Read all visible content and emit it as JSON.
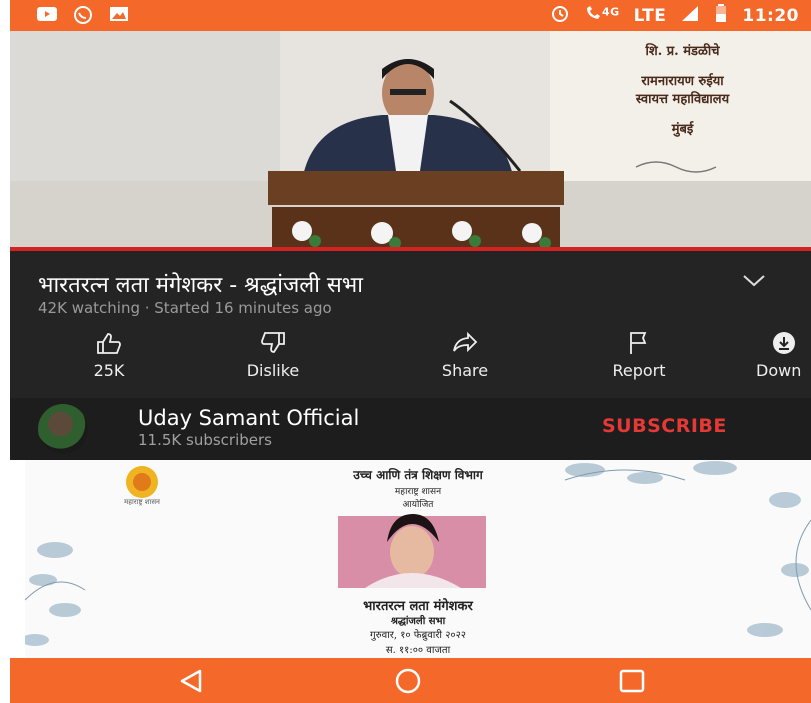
{
  "status_bar": {
    "time": "11:20",
    "network_small": "4G",
    "network": "LTE",
    "icons": [
      "youtube-notification-icon",
      "whatsapp-icon",
      "gallery-icon",
      "alarm-icon",
      "call-4g-icon",
      "signal-icon",
      "battery-icon"
    ]
  },
  "video": {
    "slide_lines": [
      "शि. प्र. मंडळीचे",
      "रामनारायण रुईया",
      "स्वायत्त महाविद्यालय",
      "मुंबई"
    ]
  },
  "info": {
    "title": "भारतरत्न लता मंगेशकर - श्रद्धांजली सभा",
    "meta": "42K watching · Started 16 minutes ago"
  },
  "actions": [
    {
      "label": "25K",
      "icon": "thumb-up-icon"
    },
    {
      "label": "Dislike",
      "icon": "thumb-down-icon"
    },
    {
      "label": "Share",
      "icon": "share-icon"
    },
    {
      "label": "Report",
      "icon": "flag-icon"
    },
    {
      "label": "Down",
      "icon": "download-icon"
    }
  ],
  "channel": {
    "name": "Uday Samant Official",
    "subscribers": "11.5K subscribers",
    "subscribe_label": "SUBSCRIBE"
  },
  "poster": {
    "header": "उच्च आणि तंत्र शिक्षण विभाग",
    "sub1": "महाराष्ट्र शासन",
    "sub2": "आयोजित",
    "emblem_label": "महाराष्ट्र शासन",
    "name": "भारतरत्न लता मंगेशकर",
    "event": "श्रद्धांजली सभा",
    "date": "गुरुवार, १० फेब्रुवारी २०२२",
    "time": "स. ११:०० वाजता"
  },
  "colors": {
    "accent": "#f4682a",
    "subscribe": "#e53935",
    "panel": "#242424"
  }
}
